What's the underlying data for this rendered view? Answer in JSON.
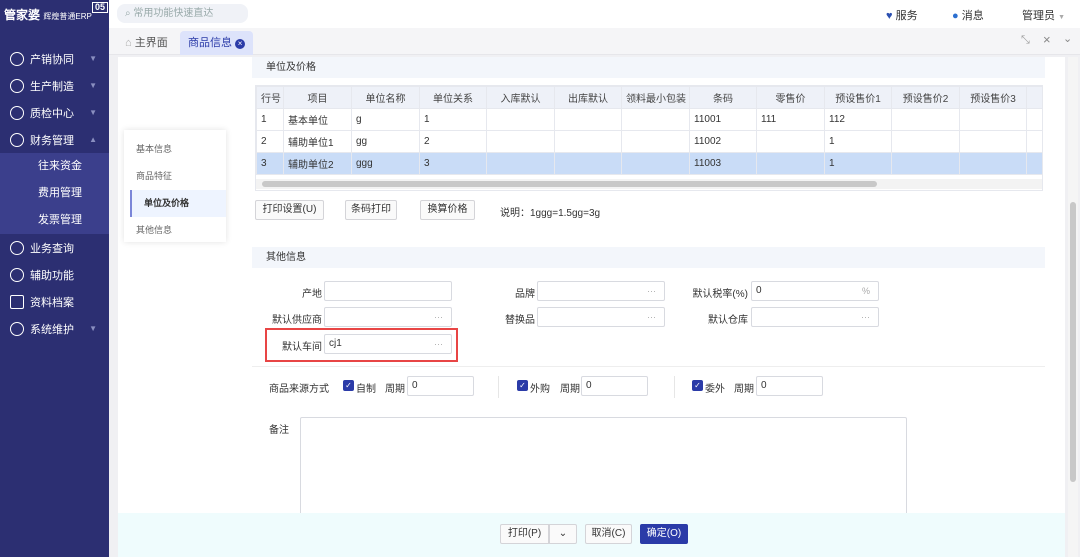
{
  "app": {
    "logo": "管家婆",
    "logo_sub": "辉煌普通ERP",
    "logo_tag": "05"
  },
  "sidebar": {
    "items": [
      {
        "label": "产销协同",
        "icon": "chart-circle-icon"
      },
      {
        "label": "生产制造",
        "icon": "robot-arm-icon"
      },
      {
        "label": "质检中心",
        "icon": "shield-icon"
      },
      {
        "label": "财务管理",
        "icon": "money-icon",
        "expanded": true,
        "children": [
          "往来资金",
          "费用管理",
          "发票管理"
        ]
      },
      {
        "label": "业务查询",
        "icon": "search-list-icon"
      },
      {
        "label": "辅助功能",
        "icon": "assist-icon"
      },
      {
        "label": "资料档案",
        "icon": "archive-icon"
      },
      {
        "label": "系统维护",
        "icon": "settings-icon"
      }
    ]
  },
  "topbar": {
    "search_placeholder": "常用功能快速直达",
    "service": "服务",
    "message": "消息",
    "user": "管理员"
  },
  "tabs": [
    {
      "label": "主界面",
      "icon": "home-icon"
    },
    {
      "label": "商品信息",
      "active": true
    }
  ],
  "leftnav": [
    "基本信息",
    "商品特征",
    "单位及价格",
    "其他信息"
  ],
  "units": {
    "title": "单位及价格",
    "columns": [
      "行号",
      "项目",
      "单位名称",
      "单位关系",
      "入库默认",
      "出库默认",
      "领料最小包装",
      "条码",
      "零售价",
      "预设售价1",
      "预设售价2",
      "预设售价3"
    ],
    "rows": [
      [
        "1",
        "基本单位",
        "g",
        "1",
        "",
        "",
        "",
        "11001",
        "111",
        "112",
        "",
        ""
      ],
      [
        "2",
        "辅助单位1",
        "gg",
        "2",
        "",
        "",
        "",
        "11002",
        "",
        "1",
        "",
        ""
      ],
      [
        "3",
        "辅助单位2",
        "ggg",
        "3",
        "",
        "",
        "",
        "11003",
        "",
        "1",
        "",
        ""
      ]
    ],
    "selected_row": 3,
    "buttons": [
      "打印设置(U)",
      "条码打印",
      "换算价格"
    ],
    "note": "说明：1ggg=1.5gg=3g"
  },
  "other": {
    "title": "其他信息",
    "origin_label": "产地",
    "origin": "",
    "brand_label": "品牌",
    "brand": "",
    "tax_label": "默认税率(%)",
    "tax": "0",
    "tax_unit": "%",
    "supplier_label": "默认供应商",
    "supplier": "",
    "substitute_label": "替换品",
    "substitute": "",
    "warehouse_label": "默认仓库",
    "warehouse": "",
    "workshop_label": "默认车间",
    "workshop": "cj1",
    "source_label": "商品来源方式",
    "sources": [
      {
        "label": "自制",
        "checked": true,
        "period_label": "周期",
        "period": "0"
      },
      {
        "label": "外购",
        "checked": true,
        "period_label": "周期",
        "period": "0"
      },
      {
        "label": "委外",
        "checked": true,
        "period_label": "周期",
        "period": "0"
      }
    ],
    "remark_label": "备注",
    "remark": ""
  },
  "footer": {
    "print": "打印(P)",
    "cancel": "取消(C)",
    "ok": "确定(O)"
  },
  "colors": {
    "sidebar": "#2c2f72",
    "primary": "#2b3ba8",
    "highlight": "#e84545",
    "selected_row": "#c9dcf7"
  }
}
